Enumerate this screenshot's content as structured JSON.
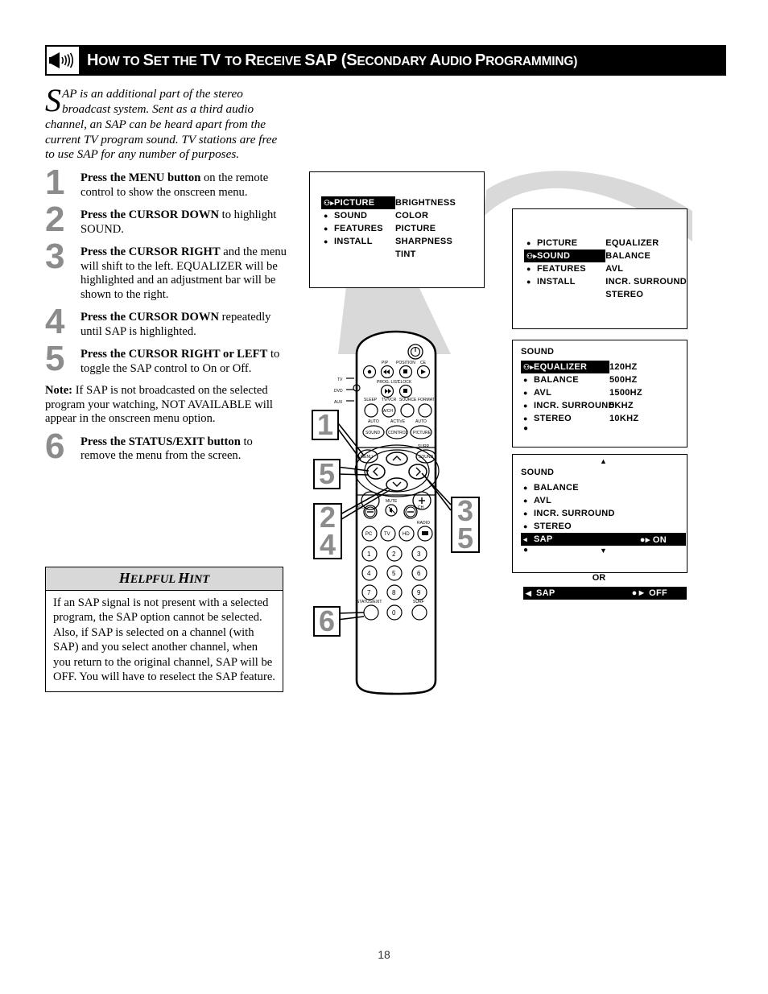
{
  "header": {
    "icon": "speaker-sound-icon",
    "title_parts": [
      {
        "t": "H",
        "caps": true
      },
      {
        "t": "OW TO ",
        "caps": false
      },
      {
        "t": "S",
        "caps": true
      },
      {
        "t": "ET THE ",
        "caps": false
      },
      {
        "t": "TV ",
        "caps": true
      },
      {
        "t": "TO ",
        "caps": false
      },
      {
        "t": "R",
        "caps": true
      },
      {
        "t": "ECEIVE ",
        "caps": false
      },
      {
        "t": "SAP (",
        "caps": true
      },
      {
        "t": "S",
        "caps": true
      },
      {
        "t": "ECONDARY ",
        "caps": false
      },
      {
        "t": "A",
        "caps": true
      },
      {
        "t": "UDIO ",
        "caps": false
      },
      {
        "t": "P",
        "caps": true
      },
      {
        "t": "ROGRAMMING)",
        "caps": false
      }
    ],
    "title_plain": "How to Set the TV to Receive SAP (Secondary Audio Programming)"
  },
  "intro": {
    "dropcap": "S",
    "text": "AP is an additional part of the stereo broadcast system.  Sent as a third audio channel, an SAP can be heard apart from the current TV program sound.  TV stations are free to use SAP for any number of purposes."
  },
  "steps": [
    {
      "num": "1",
      "bold": "Press the MENU button",
      "rest": " on the remote control to show the onscreen menu."
    },
    {
      "num": "2",
      "bold": "Press the CURSOR DOWN",
      "rest": " to highlight SOUND."
    },
    {
      "num": "3",
      "bold": "Press the CURSOR RIGHT",
      "rest": " and the menu will shift to the left. EQUALIZER will be highlighted and an adjustment bar will be shown to the right."
    },
    {
      "num": "4",
      "bold": "Press the CURSOR DOWN",
      "rest": " repeatedly until SAP is highlighted."
    },
    {
      "num": "5",
      "bold": "Press the CURSOR RIGHT or LEFT",
      "rest": " to toggle the SAP control to On or Off."
    }
  ],
  "note": {
    "label": "Note:",
    "text": " If SAP is not broadcasted on the selected program your watching, NOT AVAILABLE will appear in the onscreen menu option."
  },
  "step6": {
    "num": "6",
    "bold": "Press the STATUS/EXIT button",
    "rest": " to remove the menu from the screen."
  },
  "hint": {
    "title_first": "H",
    "title_rest1": "ELPFUL ",
    "title_second": "H",
    "title_rest2": "INT",
    "title_plain": "HELPFUL HINT",
    "body": "If an SAP signal is not present with a selected program, the SAP option cannot be selected.  Also, if SAP is selected on a channel (with SAP) and you select another channel, when you return to the original channel, SAP will be OFF.  You will have to reselect the SAP feature."
  },
  "osd_panel_1": {
    "left_items": [
      {
        "label": "PICTURE",
        "mark": "cursor",
        "highlighted": true
      },
      {
        "label": "SOUND",
        "mark": "bullet",
        "highlighted": false
      },
      {
        "label": "FEATURES",
        "mark": "bullet",
        "highlighted": false
      },
      {
        "label": "INSTALL",
        "mark": "bullet",
        "highlighted": false
      }
    ],
    "right_items": [
      "BRIGHTNESS",
      "COLOR",
      "PICTURE",
      "SHARPNESS",
      "TINT"
    ]
  },
  "osd_panel_2": {
    "left_items": [
      {
        "label": "PICTURE",
        "mark": "bullet",
        "highlighted": false
      },
      {
        "label": "SOUND",
        "mark": "cursor",
        "highlighted": true
      },
      {
        "label": "FEATURES",
        "mark": "bullet",
        "highlighted": false
      },
      {
        "label": "INSTALL",
        "mark": "bullet",
        "highlighted": false
      }
    ],
    "right_items": [
      "EQUALIZER",
      "BALANCE",
      "AVL",
      "INCR. SURROUND",
      "STEREO"
    ]
  },
  "osd_panel_3": {
    "title": "SOUND",
    "left_items": [
      {
        "label": "EQUALIZER",
        "mark": "cursor",
        "highlighted": true
      },
      {
        "label": "BALANCE",
        "mark": "bullet",
        "highlighted": false
      },
      {
        "label": "AVL",
        "mark": "bullet",
        "highlighted": false
      },
      {
        "label": "INCR. SURROUND",
        "mark": "bullet",
        "highlighted": false
      },
      {
        "label": "STEREO",
        "mark": "bullet",
        "highlighted": false
      }
    ],
    "right_items": [
      "120HZ",
      "500HZ",
      "1500HZ",
      "5KHZ",
      "10KHZ"
    ],
    "scroll_glyph": "scroll-indicator-icon"
  },
  "osd_panel_4": {
    "title": "SOUND",
    "up_arrow": "scroll-up-icon",
    "down_arrow": "scroll-down-icon",
    "items": [
      {
        "label": "BALANCE",
        "mark": "bullet",
        "highlighted": false,
        "value": ""
      },
      {
        "label": "AVL",
        "mark": "bullet",
        "highlighted": false,
        "value": ""
      },
      {
        "label": "INCR. SURROUND",
        "mark": "bullet",
        "highlighted": false,
        "value": ""
      },
      {
        "label": "STEREO",
        "mark": "bullet",
        "highlighted": false,
        "value": ""
      },
      {
        "label": "SAP",
        "mark": "left-arrow",
        "highlighted": true,
        "value": "ON"
      }
    ],
    "scroll_glyph": "scroll-indicator-icon"
  },
  "osd_or": {
    "separator": "OR",
    "off_row": {
      "label": "SAP",
      "value": "OFF",
      "highlighted": true
    }
  },
  "callouts": [
    {
      "id": "callout-1",
      "numbers": [
        "1"
      ]
    },
    {
      "id": "callout-5a",
      "numbers": [
        "5"
      ]
    },
    {
      "id": "callout-24",
      "numbers": [
        "2",
        "4"
      ]
    },
    {
      "id": "callout-35",
      "numbers": [
        "3",
        "5"
      ]
    },
    {
      "id": "callout-6",
      "numbers": [
        "6"
      ]
    }
  ],
  "remote": {
    "source_labels": [
      "TV",
      "DVD",
      "AUX"
    ],
    "top_labels": [
      "PIP",
      "POSITION",
      "CE",
      "PROG. LIST",
      "CLOCK"
    ],
    "row_labels": [
      "SLEEP",
      "TV/VCR",
      "SOURCE",
      "FORMAT",
      "A/CH"
    ],
    "auto_labels": [
      "AUTO",
      "ACTIVE",
      "AUTO"
    ],
    "auto_buttons": [
      "SOUND",
      "CONTROL",
      "PICTURE"
    ],
    "menu_button": "MENU",
    "surr_label": "SURR.",
    "sound_button": "SOUND",
    "vol_label": "VOL",
    "ch_label": "CH",
    "mute_label": "MUTE",
    "device_buttons": [
      "PC",
      "TV",
      "HD"
    ],
    "radio_label": "RADIO",
    "keypad": [
      "1",
      "2",
      "3",
      "4",
      "5",
      "6",
      "7",
      "8",
      "9",
      "0"
    ],
    "status_label": "STATUS/EXIT",
    "surf_label": "SURF"
  },
  "page": {
    "number": "18"
  }
}
